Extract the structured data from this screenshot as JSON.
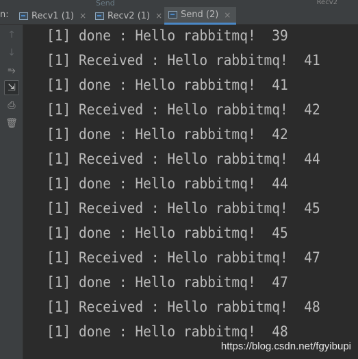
{
  "run_label": "n:",
  "overflow_tab_left": "Send",
  "overflow_tab_right": "Recv2",
  "tabs": [
    {
      "label": "Recv1 (1)",
      "close": "×",
      "active": false
    },
    {
      "label": "Recv2 (1)",
      "close": "×",
      "active": false
    },
    {
      "label": "Send (2)",
      "close": "×",
      "active": true
    }
  ],
  "toolbar": {
    "up_icon": "↑",
    "down_icon": "↓",
    "soft_wrap_icon": "⥱",
    "scroll_end_icon": "⇲",
    "print_icon": "⎙",
    "trash_icon": "🗑"
  },
  "console_lines": [
    "[1] done : Hello rabbitmq!  39",
    "[1] Received : Hello rabbitmq!  41",
    "[1] done : Hello rabbitmq!  41",
    "[1] Received : Hello rabbitmq!  42",
    "[1] done : Hello rabbitmq!  42",
    "[1] Received : Hello rabbitmq!  44",
    "[1] done : Hello rabbitmq!  44",
    "[1] Received : Hello rabbitmq!  45",
    "[1] done : Hello rabbitmq!  45",
    "[1] Received : Hello rabbitmq!  47",
    "[1] done : Hello rabbitmq!  47",
    "[1] Received : Hello rabbitmq!  48",
    "[1] done : Hello rabbitmq!  48"
  ],
  "watermark": "https://blog.csdn.net/fgyibupi"
}
